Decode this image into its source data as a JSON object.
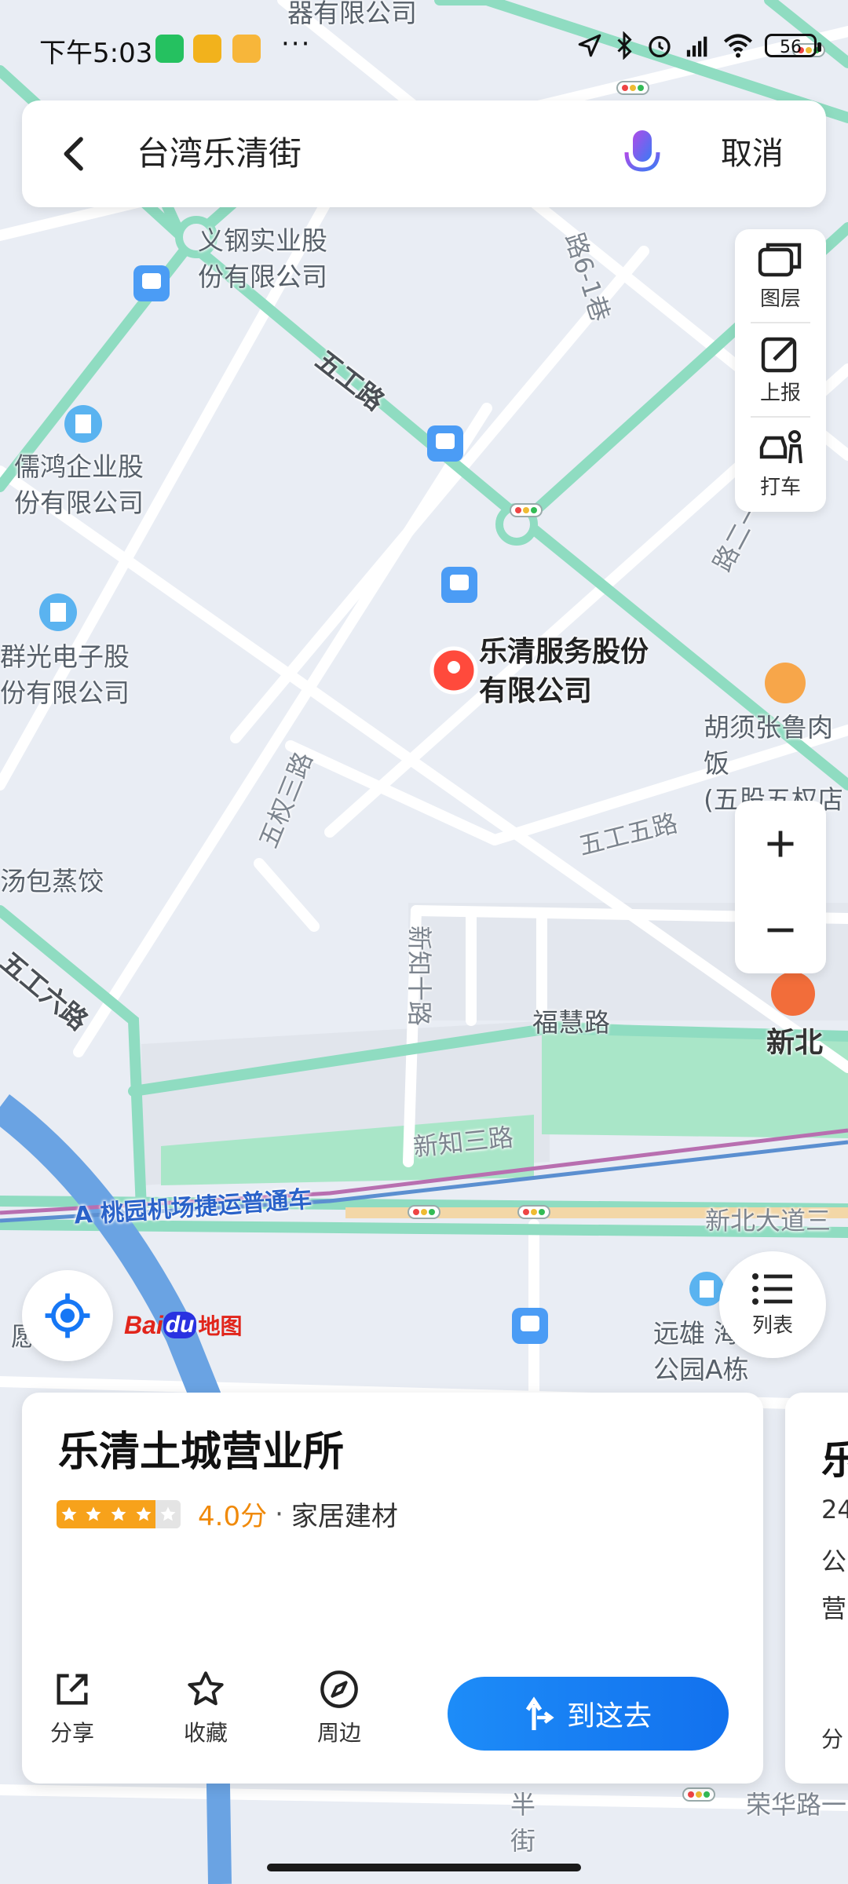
{
  "status_bar": {
    "time": "下午5:03",
    "more": "···",
    "battery": "56"
  },
  "search": {
    "query": "台湾乐清街",
    "cancel_label": "取消"
  },
  "tools": [
    {
      "label": "图层",
      "icon": "layers-icon"
    },
    {
      "label": "上报",
      "icon": "report-edit-icon"
    },
    {
      "label": "打车",
      "icon": "taxi-icon"
    }
  ],
  "zoom": {
    "in": "+",
    "out": "−"
  },
  "list_button": {
    "label": "列表"
  },
  "logo": {
    "text_bai": "Bai",
    "text_du": "du",
    "text_map": "地图"
  },
  "map": {
    "labels": {
      "top_company": "器有限公司",
      "yigang": "义钢实业股\n份有限公司",
      "wugong_road": "五工路",
      "ruhong": "儒鸿企业股\n份有限公司",
      "qunguang": "群光电子股\n份有限公司",
      "leqing_service": "乐清服务股份\n有限公司",
      "huxu": "胡须张鲁肉饭\n(五股五权店",
      "wuquan3": "五权三路",
      "wugong5": "五工五路",
      "baozi": "汤包蒸饺",
      "wugong6": "五工六路",
      "xinzhi10": "新知十路",
      "fuhui": "福慧路",
      "xinbei": "新北",
      "xinzhi3": "新知三路",
      "mrt": "A 桃园机场捷运普通车",
      "xinbei_ave": "新北大道三",
      "yuanxiong": "远雄 海\n公园A栋",
      "hui_park": "愿   园",
      "road_61": "路6-1巷",
      "road_right": "路二一",
      "ban_street": "半\n街",
      "ronghua": "荣华路一"
    }
  },
  "card": {
    "title": "乐清土城营业所",
    "rating": 4.0,
    "score_text": "4.0分",
    "separator": "·",
    "category": "家居建材",
    "actions": [
      {
        "label": "分享",
        "icon": "share-icon"
      },
      {
        "label": "收藏",
        "icon": "star-outline-icon"
      },
      {
        "label": "周边",
        "icon": "compass-icon"
      }
    ],
    "nav_label": "到这去"
  },
  "card2": {
    "title": "乐",
    "line1": "24",
    "line2": "公",
    "line3": "营",
    "action": "分"
  },
  "colors": {
    "accent": "#1677f5",
    "star": "#f7a21b",
    "road_green": "#8fdcc1",
    "map_bg": "#e9edf4"
  }
}
